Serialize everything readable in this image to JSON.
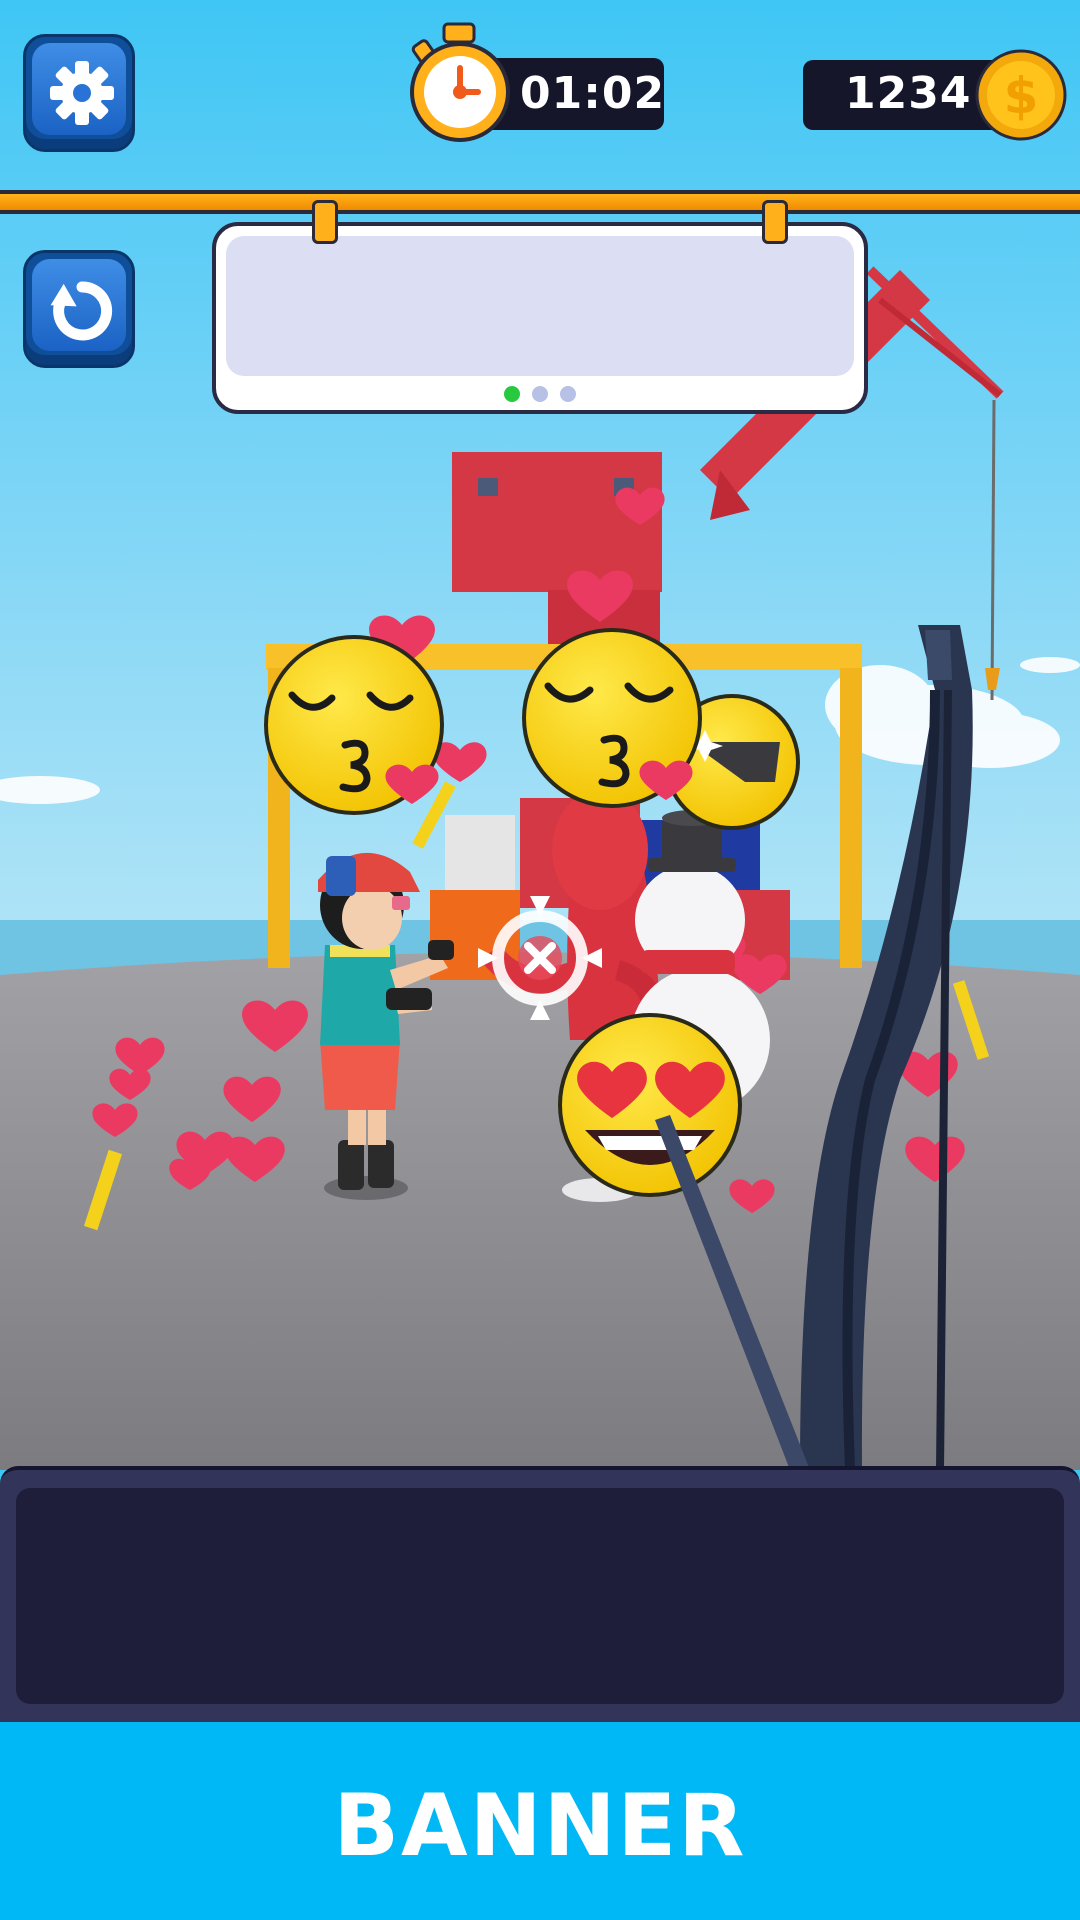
{
  "hud": {
    "settings": {
      "icon": "gear-icon"
    },
    "timer": {
      "icon": "stopwatch-icon",
      "value": "01:02"
    },
    "coins": {
      "icon": "dollar-coin-icon",
      "value": "1234"
    },
    "restart": {
      "icon": "restart-icon"
    }
  },
  "word_panel": {
    "page_dots": {
      "count": 3,
      "active_index": 0,
      "active_color": "#27c93f",
      "inactive_color": "#b7c1e6"
    }
  },
  "scene": {
    "reaction_emojis": [
      "kissing-face-emoji",
      "kissing-face-emoji",
      "sunglasses-face-emoji",
      "heart-eyes-face-emoji"
    ],
    "characters": [
      "girl-with-helmet",
      "red-lobster-costume",
      "snowman-with-top-hat"
    ],
    "crosshair_icon": "crosshair-icon",
    "weapon": "bow"
  },
  "banner": {
    "label": "BANNER"
  },
  "colors": {
    "sky": "#3fc6f5",
    "ground": "#8b8b8f",
    "accent_orange": "#ffb01a",
    "hud_blue": "#1b62c4",
    "banner": "#00b8f5"
  }
}
